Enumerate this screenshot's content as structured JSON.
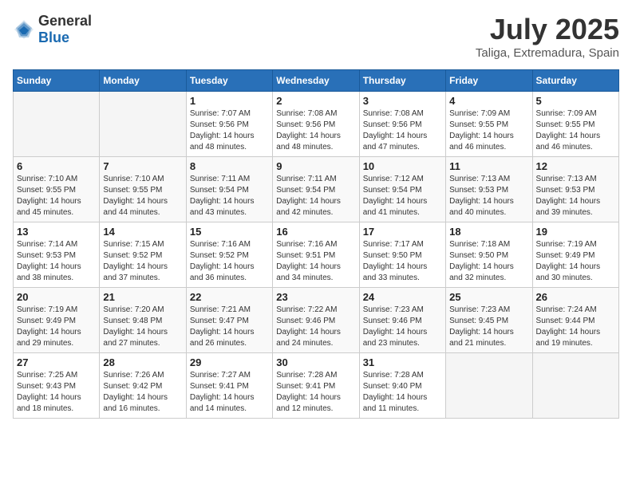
{
  "header": {
    "logo_general": "General",
    "logo_blue": "Blue",
    "title": "July 2025",
    "location": "Taliga, Extremadura, Spain"
  },
  "days_of_week": [
    "Sunday",
    "Monday",
    "Tuesday",
    "Wednesday",
    "Thursday",
    "Friday",
    "Saturday"
  ],
  "weeks": [
    [
      {
        "day": "",
        "detail": ""
      },
      {
        "day": "",
        "detail": ""
      },
      {
        "day": "1",
        "detail": "Sunrise: 7:07 AM\nSunset: 9:56 PM\nDaylight: 14 hours and 48 minutes."
      },
      {
        "day": "2",
        "detail": "Sunrise: 7:08 AM\nSunset: 9:56 PM\nDaylight: 14 hours and 48 minutes."
      },
      {
        "day": "3",
        "detail": "Sunrise: 7:08 AM\nSunset: 9:56 PM\nDaylight: 14 hours and 47 minutes."
      },
      {
        "day": "4",
        "detail": "Sunrise: 7:09 AM\nSunset: 9:55 PM\nDaylight: 14 hours and 46 minutes."
      },
      {
        "day": "5",
        "detail": "Sunrise: 7:09 AM\nSunset: 9:55 PM\nDaylight: 14 hours and 46 minutes."
      }
    ],
    [
      {
        "day": "6",
        "detail": "Sunrise: 7:10 AM\nSunset: 9:55 PM\nDaylight: 14 hours and 45 minutes."
      },
      {
        "day": "7",
        "detail": "Sunrise: 7:10 AM\nSunset: 9:55 PM\nDaylight: 14 hours and 44 minutes."
      },
      {
        "day": "8",
        "detail": "Sunrise: 7:11 AM\nSunset: 9:54 PM\nDaylight: 14 hours and 43 minutes."
      },
      {
        "day": "9",
        "detail": "Sunrise: 7:11 AM\nSunset: 9:54 PM\nDaylight: 14 hours and 42 minutes."
      },
      {
        "day": "10",
        "detail": "Sunrise: 7:12 AM\nSunset: 9:54 PM\nDaylight: 14 hours and 41 minutes."
      },
      {
        "day": "11",
        "detail": "Sunrise: 7:13 AM\nSunset: 9:53 PM\nDaylight: 14 hours and 40 minutes."
      },
      {
        "day": "12",
        "detail": "Sunrise: 7:13 AM\nSunset: 9:53 PM\nDaylight: 14 hours and 39 minutes."
      }
    ],
    [
      {
        "day": "13",
        "detail": "Sunrise: 7:14 AM\nSunset: 9:53 PM\nDaylight: 14 hours and 38 minutes."
      },
      {
        "day": "14",
        "detail": "Sunrise: 7:15 AM\nSunset: 9:52 PM\nDaylight: 14 hours and 37 minutes."
      },
      {
        "day": "15",
        "detail": "Sunrise: 7:16 AM\nSunset: 9:52 PM\nDaylight: 14 hours and 36 minutes."
      },
      {
        "day": "16",
        "detail": "Sunrise: 7:16 AM\nSunset: 9:51 PM\nDaylight: 14 hours and 34 minutes."
      },
      {
        "day": "17",
        "detail": "Sunrise: 7:17 AM\nSunset: 9:50 PM\nDaylight: 14 hours and 33 minutes."
      },
      {
        "day": "18",
        "detail": "Sunrise: 7:18 AM\nSunset: 9:50 PM\nDaylight: 14 hours and 32 minutes."
      },
      {
        "day": "19",
        "detail": "Sunrise: 7:19 AM\nSunset: 9:49 PM\nDaylight: 14 hours and 30 minutes."
      }
    ],
    [
      {
        "day": "20",
        "detail": "Sunrise: 7:19 AM\nSunset: 9:49 PM\nDaylight: 14 hours and 29 minutes."
      },
      {
        "day": "21",
        "detail": "Sunrise: 7:20 AM\nSunset: 9:48 PM\nDaylight: 14 hours and 27 minutes."
      },
      {
        "day": "22",
        "detail": "Sunrise: 7:21 AM\nSunset: 9:47 PM\nDaylight: 14 hours and 26 minutes."
      },
      {
        "day": "23",
        "detail": "Sunrise: 7:22 AM\nSunset: 9:46 PM\nDaylight: 14 hours and 24 minutes."
      },
      {
        "day": "24",
        "detail": "Sunrise: 7:23 AM\nSunset: 9:46 PM\nDaylight: 14 hours and 23 minutes."
      },
      {
        "day": "25",
        "detail": "Sunrise: 7:23 AM\nSunset: 9:45 PM\nDaylight: 14 hours and 21 minutes."
      },
      {
        "day": "26",
        "detail": "Sunrise: 7:24 AM\nSunset: 9:44 PM\nDaylight: 14 hours and 19 minutes."
      }
    ],
    [
      {
        "day": "27",
        "detail": "Sunrise: 7:25 AM\nSunset: 9:43 PM\nDaylight: 14 hours and 18 minutes."
      },
      {
        "day": "28",
        "detail": "Sunrise: 7:26 AM\nSunset: 9:42 PM\nDaylight: 14 hours and 16 minutes."
      },
      {
        "day": "29",
        "detail": "Sunrise: 7:27 AM\nSunset: 9:41 PM\nDaylight: 14 hours and 14 minutes."
      },
      {
        "day": "30",
        "detail": "Sunrise: 7:28 AM\nSunset: 9:41 PM\nDaylight: 14 hours and 12 minutes."
      },
      {
        "day": "31",
        "detail": "Sunrise: 7:28 AM\nSunset: 9:40 PM\nDaylight: 14 hours and 11 minutes."
      },
      {
        "day": "",
        "detail": ""
      },
      {
        "day": "",
        "detail": ""
      }
    ]
  ]
}
